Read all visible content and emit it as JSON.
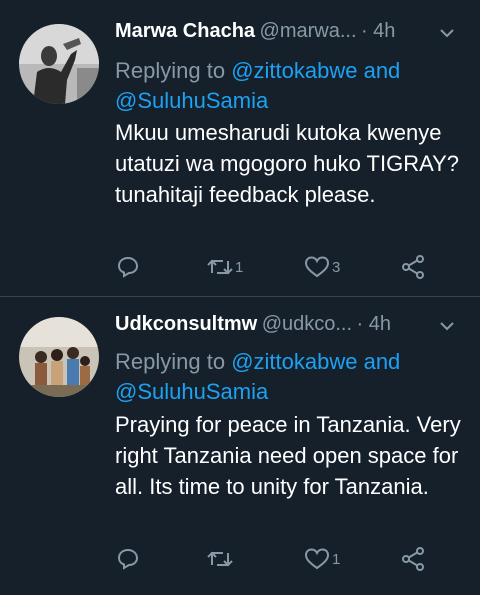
{
  "tweets": [
    {
      "name": "Marwa Chacha",
      "handle": "@marwa...",
      "time": "· 4h",
      "replying_prefix": "Replying to ",
      "reply_to_1": "@zittokabwe",
      "reply_and": " and",
      "reply_to_2": "@SuluhuSamia",
      "text": "Mkuu umesharudi kutoka kwenye utatuzi wa mgogoro huko TIGRAY?tunahitaji feedback please.",
      "retweet_count": "1",
      "like_count": "3"
    },
    {
      "name": "Udkconsultmw",
      "handle": "@udkco...",
      "time": "· 4h",
      "replying_prefix": "Replying to ",
      "reply_to_1": "@zittokabwe",
      "reply_and": " and",
      "reply_to_2": "@SuluhuSamia",
      "text": "Praying for peace in Tanzania. Very right Tanzania need open space for all. Its time to unity for Tanzania.",
      "retweet_count": "",
      "like_count": "1"
    }
  ],
  "icons": {
    "reply": "reply-icon",
    "retweet": "retweet-icon",
    "like": "heart-icon",
    "share": "share-icon",
    "menu": "chevron-down-icon"
  },
  "colors": {
    "background": "#15202b",
    "link": "#1da1f2",
    "secondary": "#8899a6",
    "divider": "#38444d"
  }
}
